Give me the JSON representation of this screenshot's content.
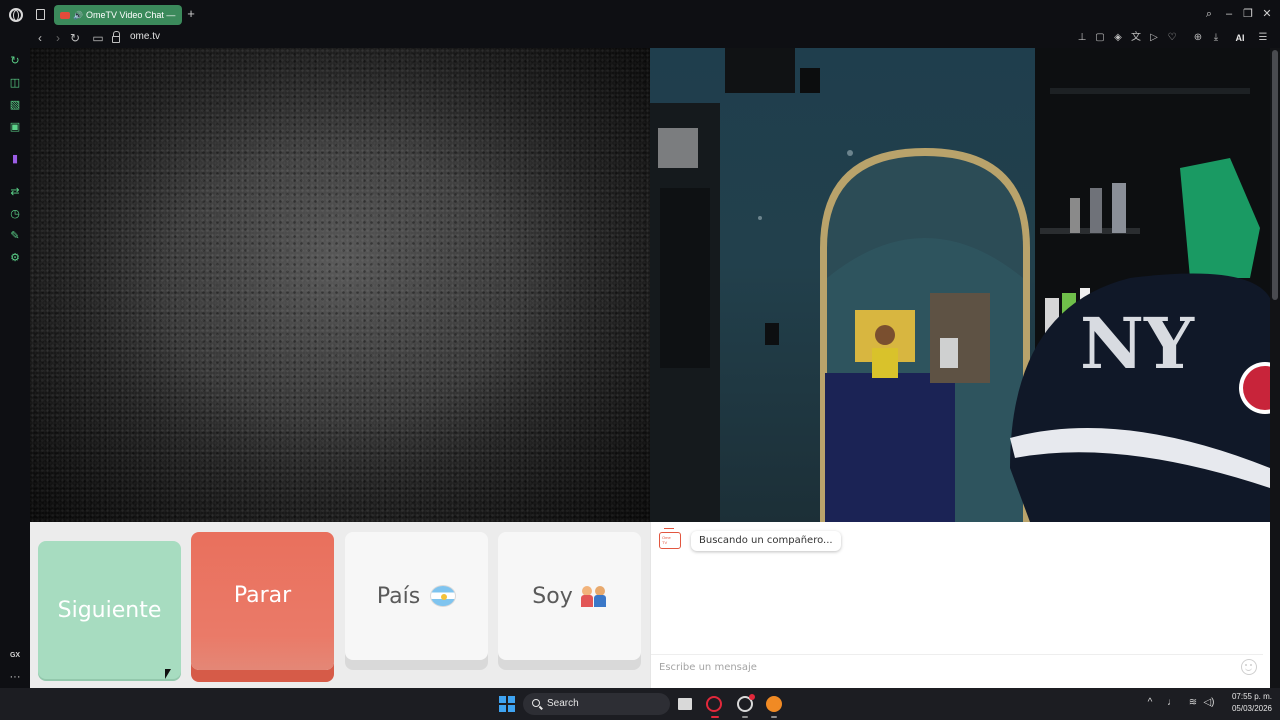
{
  "browser": {
    "tab_title": "OmeTV Video Chat — ",
    "new_tab_symbol": "+",
    "url": "ome.tv",
    "ai_label": "AI",
    "window_controls": {
      "search": "⌕",
      "minimize": "–",
      "restore": "❐",
      "close": "✕"
    },
    "nav": {
      "back": "‹",
      "forward": "›",
      "reload": "↻",
      "camera": "▭"
    }
  },
  "sidebar": {
    "items": [
      {
        "icon": "refresh-icon",
        "glyph": "↻"
      },
      {
        "icon": "briefcase-icon",
        "glyph": "◫"
      },
      {
        "icon": "pattern-icon",
        "glyph": "▧"
      },
      {
        "icon": "messenger-icon",
        "glyph": "▣"
      },
      {
        "icon": "twitch-icon",
        "glyph": "▮"
      },
      {
        "icon": "flow-icon",
        "glyph": "⇄"
      },
      {
        "icon": "history-icon",
        "glyph": "◷"
      },
      {
        "icon": "extensions-icon",
        "glyph": "✎"
      },
      {
        "icon": "settings-icon",
        "glyph": "⚙"
      }
    ],
    "gx_label": "GX",
    "more_label": "···"
  },
  "controls": {
    "next_label": "Siguiente",
    "stop_label": "Parar",
    "country_label": "País",
    "gender_label": "Soy"
  },
  "chat": {
    "status": "Buscando un compañero...",
    "placeholder": "Escribe un mensaje"
  },
  "taskbar": {
    "search_label": "Search",
    "time": "07:55 p. m.",
    "date": "05/03/2026",
    "tray": {
      "chevron": "^",
      "mic": "♩",
      "wifi": "≋",
      "volume": "◁)"
    }
  }
}
